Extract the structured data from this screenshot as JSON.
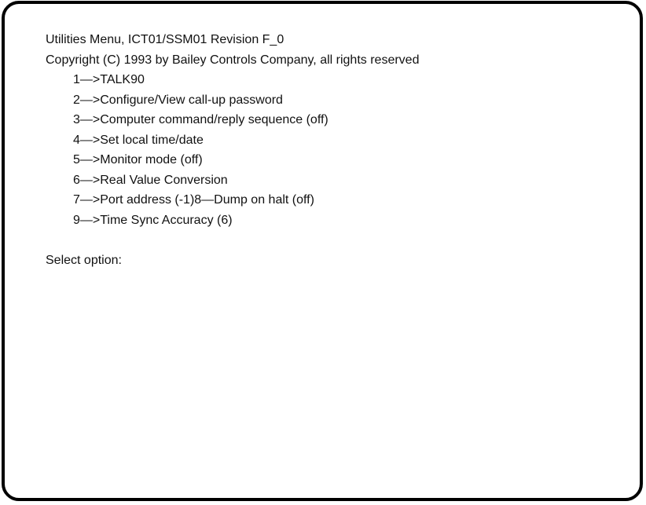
{
  "terminal": {
    "title": "Utilities Menu, ICT01/SSM01 Revision F_0",
    "copyright": "Copyright (C) 1993 by Bailey Controls Company, all rights reserved",
    "menu_items": [
      "1—>TALK90",
      "2—>Configure/View call-up password",
      "3—>Computer command/reply sequence (off)",
      "4—>Set local time/date",
      "5—>Monitor mode (off)",
      "6—>Real Value Conversion",
      "7—>Port address (-1)8—Dump on halt (off)",
      "9—>Time Sync Accuracy (6)"
    ],
    "prompt": "Select option:"
  }
}
